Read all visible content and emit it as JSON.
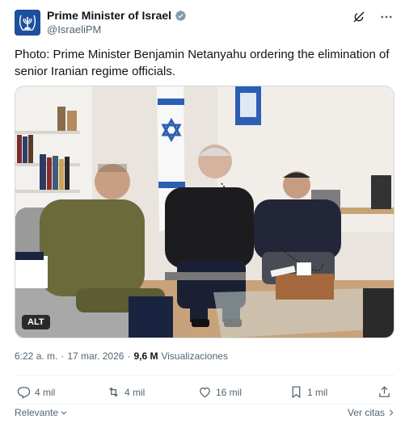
{
  "author": {
    "display_name": "Prime Minister of Israel",
    "handle": "@IsraeliPM"
  },
  "tweet": {
    "text": "Photo: Prime Minister Benjamin Netanyahu ordering the elimination of senior Iranian regime officials."
  },
  "media": {
    "alt_badge": "ALT"
  },
  "meta": {
    "time": "6:22 a. m.",
    "separator": "·",
    "date": "17 mar. 2026",
    "separator2": "·",
    "views_count": "9,6 M",
    "views_label": "Visualizaciones"
  },
  "actions": {
    "replies": "4 mil",
    "reposts": "4 mil",
    "likes": "16 mil",
    "bookmarks": "1 mil"
  },
  "footer": {
    "sort_label": "Relevante",
    "see_quotes": "Ver citas"
  },
  "colors": {
    "verified": "#829aab",
    "text_secondary": "#536471",
    "accent_blue": "#1d4f9c"
  },
  "icons": [
    "verified-badge-icon",
    "grok-icon",
    "more-icon",
    "reply-icon",
    "repost-icon",
    "like-icon",
    "bookmark-icon",
    "share-icon",
    "chevron-down-icon",
    "chevron-right-icon"
  ]
}
